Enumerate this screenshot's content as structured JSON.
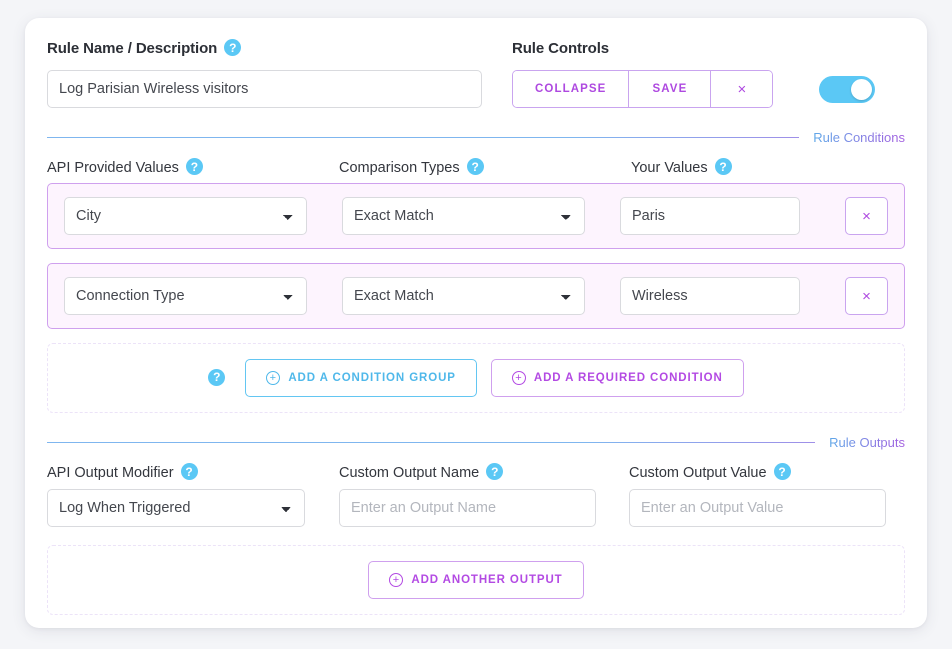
{
  "rule_name_section": {
    "label": "Rule Name / Description",
    "help_icon": "help-circle-icon",
    "value": "Log Parisian Wireless visitors"
  },
  "rule_controls": {
    "label": "Rule Controls",
    "collapse_label": "COLLAPSE",
    "save_label": "SAVE",
    "close_label": "×",
    "toggle_state": "on"
  },
  "sections": {
    "conditions_title": "Rule Conditions",
    "outputs_title": "Rule Outputs"
  },
  "conditions": {
    "headers": {
      "api_values": "API Provided Values",
      "comparison_types": "Comparison Types",
      "your_values": "Your Values"
    },
    "rows": [
      {
        "api_value": "City",
        "comparison": "Exact Match",
        "your_value": "Paris",
        "delete_label": "×"
      },
      {
        "api_value": "Connection Type",
        "comparison": "Exact Match",
        "your_value": "Wireless",
        "delete_label": "×"
      }
    ],
    "add_condition_group_label": "ADD A CONDITION GROUP",
    "add_required_condition_label": "ADD A REQUIRED CONDITION",
    "plus_glyph": "+"
  },
  "outputs": {
    "headers": {
      "api_output_modifier": "API Output Modifier",
      "custom_output_name": "Custom Output Name",
      "custom_output_value": "Custom Output Value"
    },
    "modifier_value": "Log When Triggered",
    "name_placeholder": "Enter an Output Name",
    "value_placeholder": "Enter an Output Value",
    "name_value": "",
    "value_value": "",
    "add_another_output_label": "ADD ANOTHER OUTPUT"
  },
  "colors": {
    "accent_purple": "#ae49e0",
    "accent_blue": "#5bc8f5",
    "row_border": "#cfa0ee",
    "row_bg": "#fdf4fe",
    "page_bg": "#f4f5f8"
  }
}
